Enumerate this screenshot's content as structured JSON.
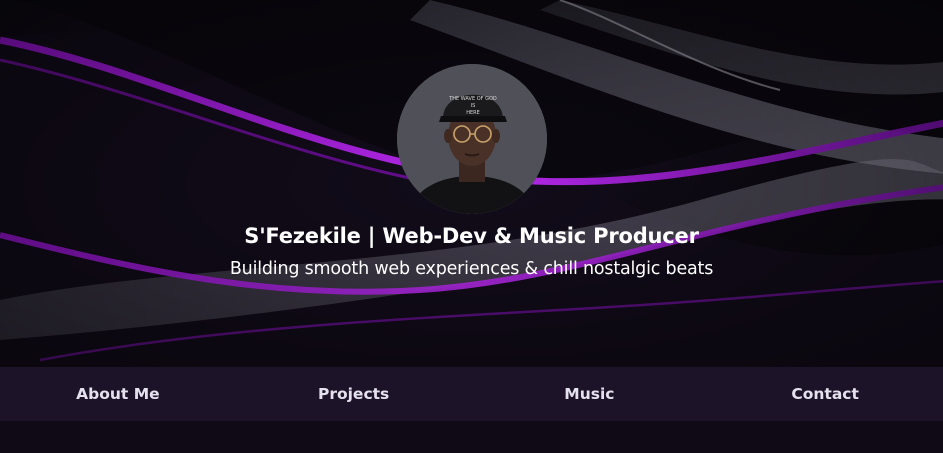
{
  "hero": {
    "title": "S'Fezekile | Web-Dev & Music Producer",
    "subtitle": "Building smooth web experiences & chill nostalgic beats",
    "avatar_cap_text": "THE WAVE OF GOD IS HERE"
  },
  "nav": {
    "items": [
      {
        "label": "About Me"
      },
      {
        "label": "Projects"
      },
      {
        "label": "Music"
      },
      {
        "label": "Contact"
      }
    ]
  },
  "colors": {
    "accent": "#b21cf0",
    "nav_bg": "#1c1328",
    "page_bg": "#0f0a16"
  }
}
